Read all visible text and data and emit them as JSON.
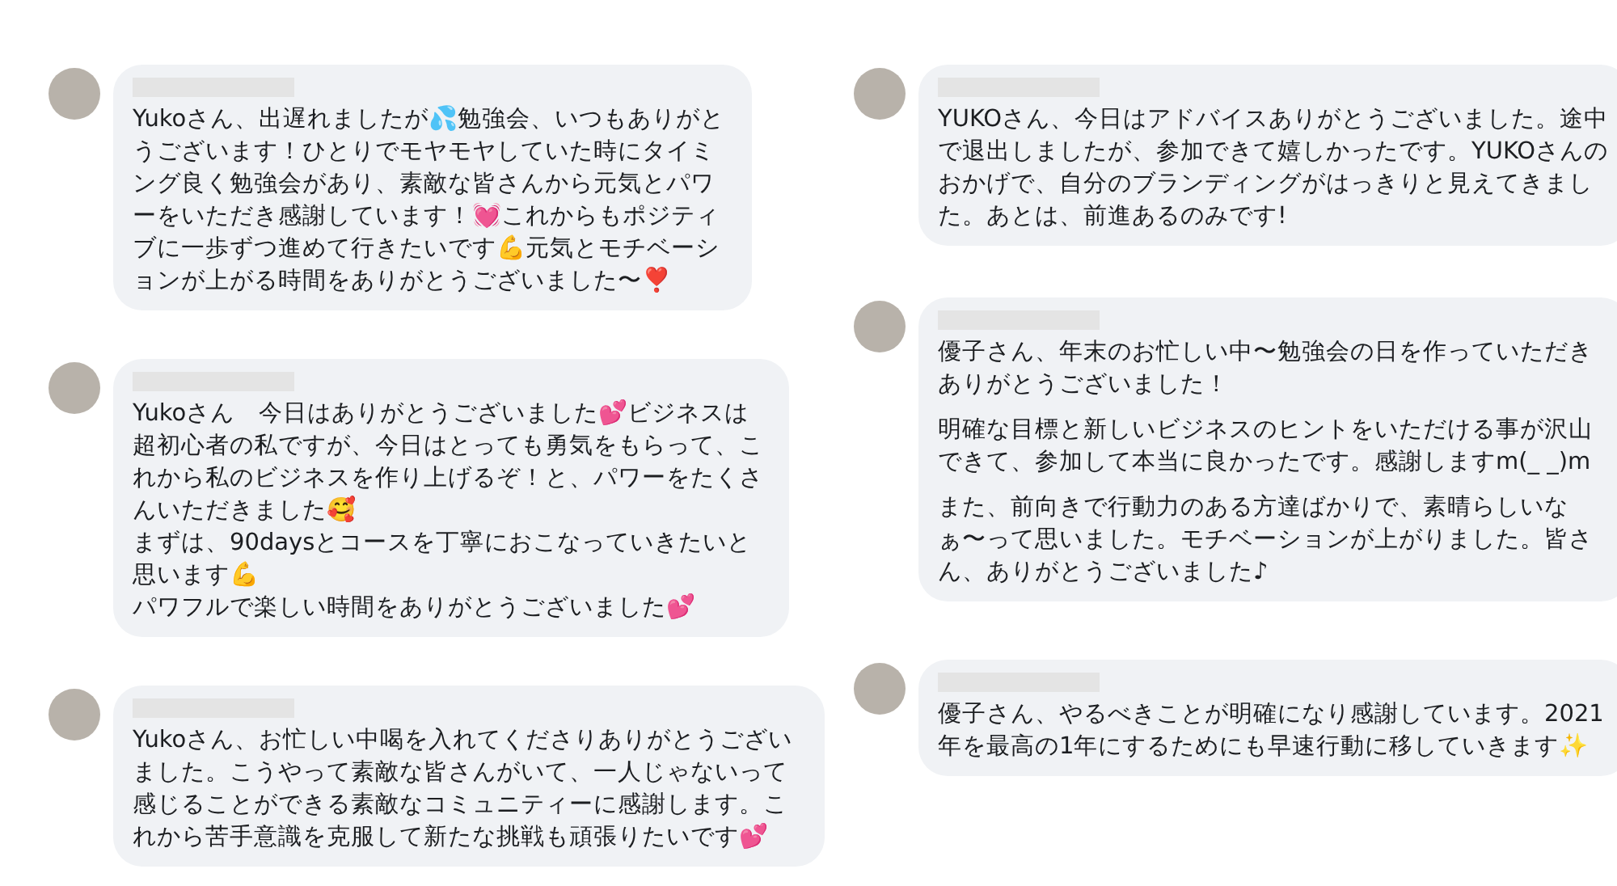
{
  "columns": [
    {
      "comments": [
        {
          "paragraphs": [
            "Yukoさん、出遅れましたが💦勉強会、いつもありがとうございます！ひとりでモヤモヤしていた時にタイミング良く勉強会があり、素敵な皆さんから元気とパワーをいただき感謝しています！💓これからもポジティブに一歩ずつ進めて行きたいです💪元気とモチベーションが上がる時間をありがとうございました〜❣️"
          ]
        },
        {
          "paragraphs": [
            "Yukoさん　今日はありがとうございました💕ビジネスは超初心者の私ですが、今日はとっても勇気をもらって、これから私のビジネスを作り上げるぞ！と、パワーをたくさんいただきました🥰\nまずは、90daysとコースを丁寧におこなっていきたいと思います💪\nパワフルで楽しい時間をありがとうございました💕"
          ]
        },
        {
          "paragraphs": [
            "Yukoさん、お忙しい中喝を入れてくださりありがとうございました。こうやって素敵な皆さんがいて、一人じゃないって感じることができる素敵なコミュニティーに感謝します。これから苦手意識を克服して新たな挑戦も頑張りたいです💕"
          ]
        }
      ]
    },
    {
      "comments": [
        {
          "paragraphs": [
            "YUKOさん、今日はアドバイスありがとうございました。途中で退出しましたが、参加できて嬉しかったです。YUKOさんのおかげで、自分のブランディングがはっきりと見えてきました。あとは、前進あるのみです!"
          ]
        },
        {
          "paragraphs": [
            "優子さん、年末のお忙しい中〜勉強会の日を作っていただきありがとうございました！",
            "明確な目標と新しいビジネスのヒントをいただける事が沢山できて、参加して本当に良かったです。感謝しますm(_ _)m",
            "また、前向きで行動力のある方達ばかりで、素晴らしいなぁ〜って思いました。モチベーションが上がりました。皆さん、ありがとうございました♪"
          ]
        },
        {
          "paragraphs": [
            "優子さん、やるべきことが明確になり感謝しています。2021年を最高の1年にするためにも早速行動に移していきます✨"
          ]
        }
      ]
    }
  ]
}
